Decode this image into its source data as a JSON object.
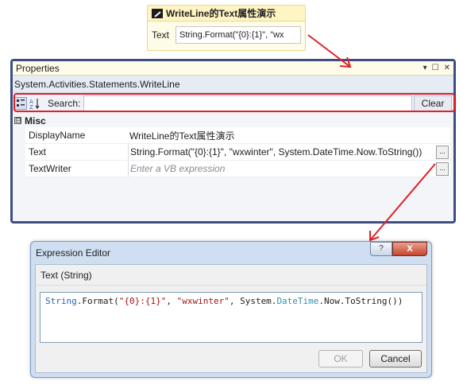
{
  "activity": {
    "title": "WriteLine的Text属性演示",
    "text_label": "Text",
    "text_value": "String.Format(\"{0}:{1}\", \"wx"
  },
  "properties": {
    "title": "Properties",
    "title_controls": [
      "▾",
      "☐",
      "✕"
    ],
    "type_name": "System.Activities.Statements.WriteLine",
    "toolbar": {
      "search_label": "Search:",
      "search_value": "",
      "clear_label": "Clear"
    },
    "section": {
      "expander": "⊟",
      "label": "Misc"
    },
    "rows": [
      {
        "name": "DisplayName",
        "value": "WriteLine的Text属性演示"
      },
      {
        "name": "Text",
        "value": "String.Format(\"{0}:{1}\", \"wxwinter\", System.DateTime.Now.ToString())"
      },
      {
        "name": "TextWriter",
        "placeholder": "Enter a VB expression"
      }
    ],
    "ellipsis": "..."
  },
  "dialog": {
    "title": "Expression Editor",
    "help_label": "?",
    "close_label": "X",
    "header": "Text (String)",
    "code_tokens": [
      {
        "t": "String",
        "k": "kw"
      },
      {
        "t": ".Format(",
        "k": "pl"
      },
      {
        "t": "\"{0}:{1}\"",
        "k": "str"
      },
      {
        "t": ", ",
        "k": "pl"
      },
      {
        "t": "\"wxwinter\"",
        "k": "str"
      },
      {
        "t": ", System.",
        "k": "pl"
      },
      {
        "t": "DateTime",
        "k": "typ"
      },
      {
        "t": ".Now.ToString())",
        "k": "pl"
      }
    ],
    "ok_label": "OK",
    "cancel_label": "Cancel"
  },
  "colors": {
    "annotation_red": "#e0202a",
    "window_border": "#3d4f80",
    "activity_bg": "#fefbe6"
  }
}
